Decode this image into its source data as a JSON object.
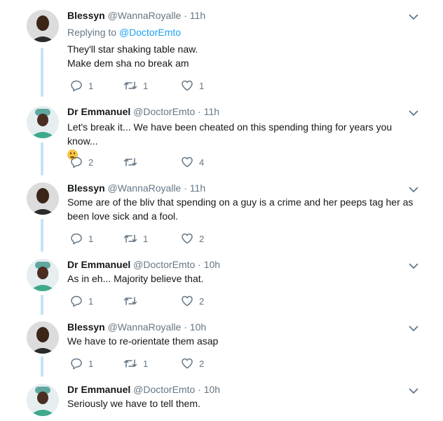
{
  "tweets": [
    {
      "name": "Blessyn",
      "handle": "@WannaRoyalle",
      "time": "11h",
      "replying_prefix": "Replying to",
      "replying_to": "@DoctorEmto",
      "lines": [
        "They'll star shaking table naw.",
        "Make dem sha no break am"
      ],
      "replies": "1",
      "retweets": "1",
      "likes": "1",
      "avatar": "man-dark"
    },
    {
      "name": "Dr Emmanuel",
      "handle": "@DoctorEmto",
      "time": "11h",
      "lines": [
        "Let's break it... We have been cheated on this spending thing for years you know..."
      ],
      "emoji": "thinking-face-emoji",
      "replies": "2",
      "retweets": "",
      "likes": "4",
      "avatar": "doctor-scrubs"
    },
    {
      "name": "Blessyn",
      "handle": "@WannaRoyalle",
      "time": "11h",
      "lines": [
        "Some are of the bliv that spending on a guy is a crime and her peeps tag her as",
        "been love sick and a fool."
      ],
      "replies": "1",
      "retweets": "1",
      "likes": "2",
      "avatar": "man-dark"
    },
    {
      "name": "Dr Emmanuel",
      "handle": "@DoctorEmto",
      "time": "10h",
      "lines": [
        "As in eh... Majority believe that."
      ],
      "replies": "1",
      "retweets": "",
      "likes": "2",
      "avatar": "doctor-scrubs"
    },
    {
      "name": "Blessyn",
      "handle": "@WannaRoyalle",
      "time": "10h",
      "lines": [
        "We have to re-orientate them asap"
      ],
      "replies": "1",
      "retweets": "1",
      "likes": "2",
      "avatar": "man-dark"
    },
    {
      "name": "Dr Emmanuel",
      "handle": "@DoctorEmto",
      "time": "10h",
      "lines": [
        "Seriously we have to tell them."
      ],
      "replies": "",
      "retweets": "",
      "likes": "",
      "avatar": "doctor-scrubs"
    }
  ],
  "separator": "·",
  "colors": {
    "accent": "#1da1f2",
    "muted": "#657786",
    "thread_line": "#c4e2f6",
    "text": "#14171a"
  },
  "icons": {
    "reply": "reply-icon",
    "retweet": "retweet-icon",
    "like": "heart-icon",
    "menu": "chevron-down-icon"
  }
}
